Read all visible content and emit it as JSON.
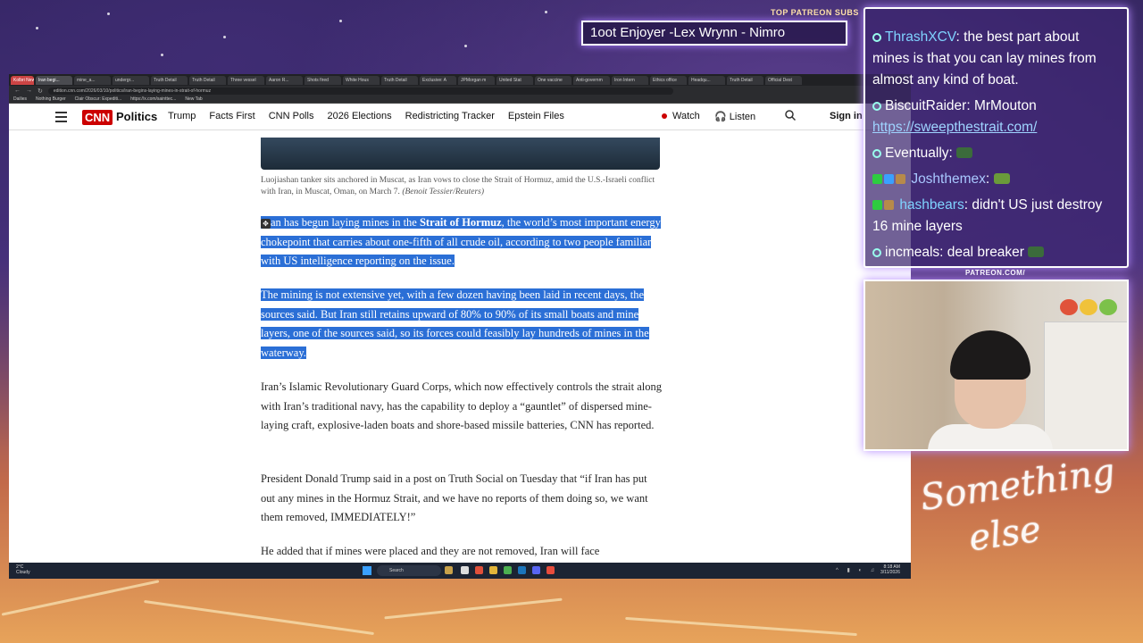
{
  "overlay": {
    "sub_label": "TOP PATREON SUBS",
    "sub_ticker": "1oot Enjoyer -Lex Wrynn - Nimro",
    "patreon_url_label": "PATREON.COM/",
    "logo_text_1": "Something",
    "logo_text_2": "else"
  },
  "browser": {
    "tabs": [
      "Kolbri News",
      "Iran begi...",
      "mine_a...",
      "undergr...",
      "Truth Detail",
      "Truth Detail",
      "Three vessel",
      "Aaron R...",
      "Shots fired",
      "White Hous",
      "Truth Detail",
      "Exclusive: A",
      "JPMorgan m",
      "United Stat",
      "One vaccine",
      "Anti-governm",
      "Iron Intern",
      "Ethics office",
      "Headqu...",
      "Truth Detail",
      "Official Dest"
    ],
    "url": "edition.cnn.com/2026/03/10/politics/iran-begins-laying-mines-in-strait-of-hormuz",
    "bookmarks": [
      "Dailies",
      "Nothing Burger",
      "Clair Obscur: Expediti...",
      "https://x.com/sainttec...",
      "New Tab"
    ]
  },
  "cnn": {
    "logo": "CNN",
    "section": "Politics",
    "nav": [
      "Trump",
      "Facts First",
      "CNN Polls",
      "2026 Elections",
      "Redistricting Tracker",
      "Epstein Files"
    ],
    "watch": "Watch",
    "listen": "Listen",
    "sign_in": "Sign in"
  },
  "article": {
    "caption": "Luojiashan tanker sits anchored in Muscat, as Iran vows to close the Strait of Hormuz, amid the U.S.-Israeli conflict with Iran, in Muscat, Oman, on March 7.",
    "credit": "(Benoit Tessier/Reuters)",
    "p1_pre": "an has begun laying mines in the ",
    "p1_bold": "Strait of Hormuz",
    "p1_post": ", the world’s most important energy chokepoint that carries about one-fifth of all crude oil, according to two people familiar with US intelligence reporting on the issue.",
    "p2": "The mining is not extensive yet, with a few dozen having been laid in recent days, the sources said. But Iran still retains upward of 80% to 90% of its small boats and mine layers, one of the sources said, so its forces could feasibly lay hundreds of mines in the waterway.",
    "p3": "Iran’s Islamic Revolutionary Guard Corps, which now effectively controls the strait along with Iran’s traditional navy, has the capability to deploy a “gauntlet” of dispersed mine-laying craft, explosive-laden boats and shore-based missile batteries, CNN has reported.",
    "p4": "President Donald Trump said in a post on Truth Social on Tuesday that “if Iran has put out any mines in the Hormuz Strait, and we have no reports of them doing so, we want them removed, IMMEDIATELY!”",
    "p5": "He added that if mines were placed and they are not removed, Iran will face"
  },
  "taskbar": {
    "weather_temp": "2°C",
    "weather_desc": "Cloudy",
    "search": "Search",
    "time": "8:18 AM",
    "date": "3/11/2026"
  },
  "chat": {
    "messages": [
      {
        "user": "ThrashXCV",
        "user_color": "#7fd3ff",
        "text": "the best part about mines is that you can lay mines from almost any kind of boat."
      },
      {
        "user": "BiscuitRaider",
        "user_color": "#ffffff",
        "text": "MrMouton",
        "link": "https://sweepthestrait.com/"
      },
      {
        "user": "Eventually",
        "user_color": "#ffffff",
        "text": ""
      },
      {
        "user": "Joshthemex",
        "user_color": "#a9c8ff",
        "text": ""
      },
      {
        "user": "hashbears",
        "user_color": "#7fd3ff",
        "text": "didn't US just destroy 16 mine layers"
      },
      {
        "user": "incmeals",
        "user_color": "#ffffff",
        "text": "deal breaker"
      }
    ]
  }
}
